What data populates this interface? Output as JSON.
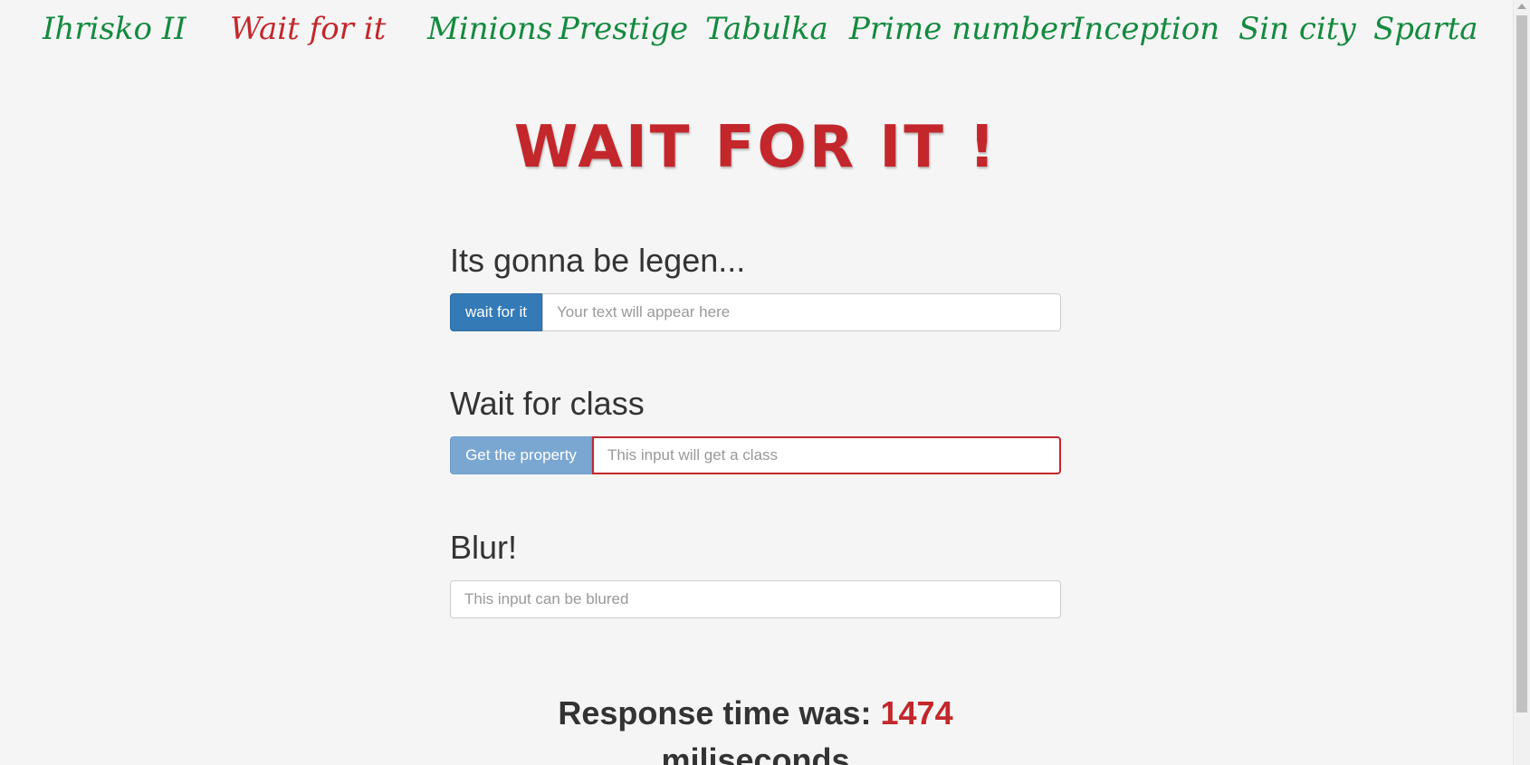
{
  "nav": {
    "items": [
      {
        "label": "Ihrisko II",
        "active": false
      },
      {
        "label": "Wait for it",
        "active": true
      },
      {
        "label": "Minions",
        "active": false
      },
      {
        "label": "Prestige",
        "active": false
      },
      {
        "label": "Tabulka",
        "active": false
      },
      {
        "label": "Prime number",
        "active": false
      },
      {
        "label": "Inception",
        "active": false
      },
      {
        "label": "Sin city",
        "active": false
      },
      {
        "label": "Sparta",
        "active": false
      }
    ]
  },
  "title": "WAIT FOR IT !",
  "sections": {
    "legen": {
      "heading": "Its gonna be legen...",
      "button_label": "wait for it",
      "input_placeholder": "Your text will appear here",
      "input_value": ""
    },
    "wait_class": {
      "heading": "Wait for class",
      "button_label": "Get the property",
      "input_placeholder": "This input will get a class",
      "input_value": ""
    },
    "blur": {
      "heading": "Blur!",
      "input_placeholder": "This input can be blured",
      "input_value": ""
    }
  },
  "response": {
    "prefix": "Response time was:",
    "value": "1474",
    "suffix": "miliseconds"
  },
  "colors": {
    "nav_green": "#138a3e",
    "active_red": "#c3272b",
    "primary_blue": "#337ab7"
  }
}
